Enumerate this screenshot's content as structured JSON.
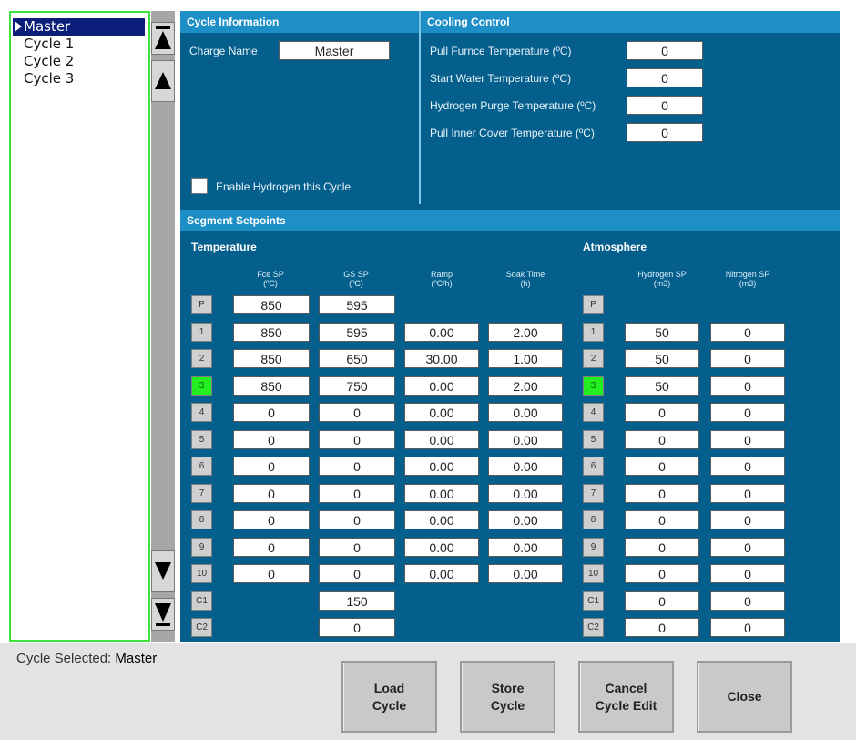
{
  "cycle_list": {
    "items": [
      "Master",
      "Cycle 1",
      "Cycle 2",
      "Cycle 3"
    ],
    "selected_index": 0
  },
  "cycle_info": {
    "title": "Cycle Information",
    "charge_name_label": "Charge Name",
    "charge_name_value": "Master",
    "enable_hydrogen_label": "Enable Hydrogen this Cycle",
    "enable_hydrogen_checked": false
  },
  "cooling": {
    "title": "Cooling Control",
    "fields": [
      {
        "label": "Pull Furnce Temperature (ºC)",
        "value": "0"
      },
      {
        "label": "Start Water Temperature (ºC)",
        "value": "0"
      },
      {
        "label": "Hydrogen Purge Temperature (ºC)",
        "value": "0"
      },
      {
        "label": "Pull Inner Cover Temperature (ºC)",
        "value": "0"
      }
    ]
  },
  "segments": {
    "title": "Segment Setpoints",
    "temperature_label": "Temperature",
    "atmosphere_label": "Atmosphere",
    "headers": {
      "fce_sp": "Fce SP\n(ºC)",
      "gs_sp": "GS SP\n(ºC)",
      "ramp": "Ramp\n(ºC/h)",
      "soak": "Soak Time\n(h)",
      "h2_sp": "Hydrogen SP\n(m3)",
      "n2_sp": "Nitrogen SP\n(m3)"
    },
    "active_row": "3",
    "rows": [
      {
        "id": "P",
        "fce": "850",
        "gs": "595",
        "ramp": null,
        "soak": null,
        "h2": "",
        "n2": ""
      },
      {
        "id": "1",
        "fce": "850",
        "gs": "595",
        "ramp": "0.00",
        "soak": "2.00",
        "h2": "50",
        "n2": "0"
      },
      {
        "id": "2",
        "fce": "850",
        "gs": "650",
        "ramp": "30.00",
        "soak": "1.00",
        "h2": "50",
        "n2": "0"
      },
      {
        "id": "3",
        "fce": "850",
        "gs": "750",
        "ramp": "0.00",
        "soak": "2.00",
        "h2": "50",
        "n2": "0"
      },
      {
        "id": "4",
        "fce": "0",
        "gs": "0",
        "ramp": "0.00",
        "soak": "0.00",
        "h2": "0",
        "n2": "0"
      },
      {
        "id": "5",
        "fce": "0",
        "gs": "0",
        "ramp": "0.00",
        "soak": "0.00",
        "h2": "0",
        "n2": "0"
      },
      {
        "id": "6",
        "fce": "0",
        "gs": "0",
        "ramp": "0.00",
        "soak": "0.00",
        "h2": "0",
        "n2": "0"
      },
      {
        "id": "7",
        "fce": "0",
        "gs": "0",
        "ramp": "0.00",
        "soak": "0.00",
        "h2": "0",
        "n2": "0"
      },
      {
        "id": "8",
        "fce": "0",
        "gs": "0",
        "ramp": "0.00",
        "soak": "0.00",
        "h2": "0",
        "n2": "0"
      },
      {
        "id": "9",
        "fce": "0",
        "gs": "0",
        "ramp": "0.00",
        "soak": "0.00",
        "h2": "0",
        "n2": "0"
      },
      {
        "id": "10",
        "fce": "0",
        "gs": "0",
        "ramp": "0.00",
        "soak": "0.00",
        "h2": "0",
        "n2": "0"
      },
      {
        "id": "C1",
        "fce": null,
        "gs": "150",
        "ramp": null,
        "soak": null,
        "h2": "0",
        "n2": "0"
      },
      {
        "id": "C2",
        "fce": null,
        "gs": "0",
        "ramp": null,
        "soak": null,
        "h2": "0",
        "n2": "0"
      }
    ]
  },
  "footer": {
    "cycle_selected_label": "Cycle Selected:",
    "cycle_selected_value": "Master",
    "buttons": [
      "Load\nCycle",
      "Store\nCycle",
      "Cancel\nCycle Edit",
      "Close"
    ]
  },
  "colors": {
    "panel_bg": "#055f8c",
    "section_bar": "#1d8fc6",
    "active_segment": "#22ee22",
    "list_border": "#3ee23e",
    "selected_item": "#0a1e7a"
  }
}
